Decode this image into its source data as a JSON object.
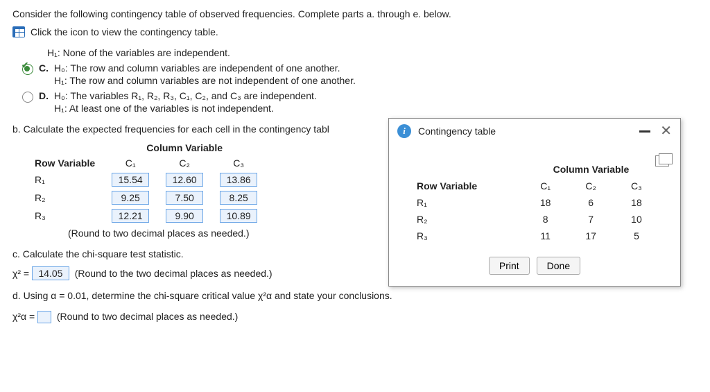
{
  "intro": "Consider the following contingency table of observed frequencies. Complete parts a. through e. below.",
  "iconLinkText": "Click the icon to view the contingency table.",
  "hiddenTop": "H₁: None of the variables are independent.",
  "optionC": {
    "label": "C.",
    "h0": "H₀: The row and column variables are independent of one another.",
    "h1": "H₁: The row and column variables are not independent of one another."
  },
  "optionD": {
    "label": "D.",
    "h0": "H₀: The variables R₁, R₂, R₃, C₁, C₂, and C₃ are independent.",
    "h1": "H₁: At least one of the variables is not independent."
  },
  "partB": "b. Calculate the expected frequencies for each cell in the contingency tabl",
  "expected": {
    "rowHeader": "Row Variable",
    "colHeader": "Column Variable",
    "cols": [
      "C₁",
      "C₂",
      "C₃"
    ],
    "rows": [
      {
        "name": "R₁",
        "vals": [
          "15.54",
          "12.60",
          "13.86"
        ]
      },
      {
        "name": "R₂",
        "vals": [
          "9.25",
          "7.50",
          "8.25"
        ]
      },
      {
        "name": "R₃",
        "vals": [
          "12.21",
          "9.90",
          "10.89"
        ]
      }
    ],
    "roundNote": "(Round to two decimal places as needed.)"
  },
  "partC": {
    "prompt": "c. Calculate the chi-square test statistic.",
    "stat": "χ² =",
    "value": "14.05",
    "note": "(Round to the two decimal places as needed.)"
  },
  "partD": {
    "prompt": "d. Using α = 0.01, determine the chi-square critical value χ²α and state your conclusions.",
    "stat": "χ²α =",
    "note": "(Round to two decimal places as needed.)"
  },
  "popup": {
    "title": "Contingency table",
    "rowHeader": "Row Variable",
    "colHeader": "Column Variable",
    "cols": [
      "C₁",
      "C₂",
      "C₃"
    ],
    "rows": [
      {
        "name": "R₁",
        "vals": [
          "18",
          "6",
          "18"
        ]
      },
      {
        "name": "R₂",
        "vals": [
          "8",
          "7",
          "10"
        ]
      },
      {
        "name": "R₃",
        "vals": [
          "11",
          "17",
          "5"
        ]
      }
    ],
    "printLabel": "Print",
    "doneLabel": "Done"
  }
}
